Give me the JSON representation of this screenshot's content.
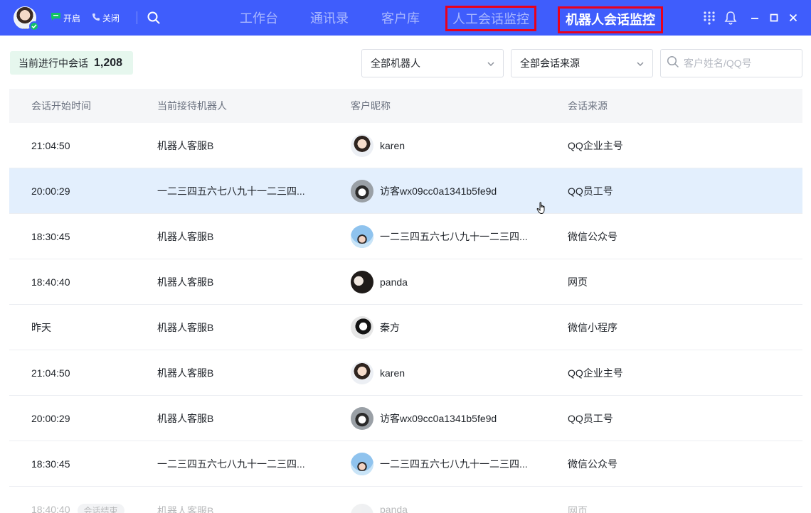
{
  "topbar": {
    "status_open_label": "开启",
    "status_close_label": "关闭",
    "tabs": [
      {
        "label": "工作台"
      },
      {
        "label": "通讯录"
      },
      {
        "label": "客户库"
      },
      {
        "label": "人工会话监控"
      },
      {
        "label": "机器人会话监控"
      }
    ],
    "brand_color": "#3f5dfc",
    "highlight_color": "#e8001c"
  },
  "filters": {
    "count_label": "当前进行中会话",
    "count_value": "1,208",
    "robot_select": "全部机器人",
    "source_select": "全部会话来源",
    "search_placeholder": "客户姓名/QQ号"
  },
  "table": {
    "headers": [
      "会话开始时间",
      "当前接待机器人",
      "客户昵称",
      "会话来源"
    ],
    "rows": [
      {
        "time": "21:04:50",
        "robot": "机器人客服B",
        "nickname": "karen",
        "source": "QQ企业主号",
        "avatar": "woman-avatar"
      },
      {
        "time": "20:00:29",
        "robot": "一二三四五六七八九十一二三四...",
        "nickname": "访客wx09cc0a1341b5fe9d",
        "source": "QQ员工号",
        "avatar": "cat-avatar"
      },
      {
        "time": "18:30:45",
        "robot": "机器人客服B",
        "nickname": "一二三四五六七八九十一二三四...",
        "source": "微信公众号",
        "avatar": "sky-avatar"
      },
      {
        "time": "18:40:40",
        "robot": "机器人客服B",
        "nickname": "panda",
        "source": "网页",
        "avatar": "dark-avatar"
      },
      {
        "time": "昨天",
        "robot": "机器人客服B",
        "nickname": "秦方",
        "source": "微信小程序",
        "avatar": "bw-avatar"
      },
      {
        "time": "21:04:50",
        "robot": "机器人客服B",
        "nickname": "karen",
        "source": "QQ企业主号",
        "avatar": "woman-avatar"
      },
      {
        "time": "20:00:29",
        "robot": "机器人客服B",
        "nickname": "访客wx09cc0a1341b5fe9d",
        "source": "QQ员工号",
        "avatar": "cat-avatar"
      },
      {
        "time": "18:30:45",
        "robot": "一二三四五六七八九十一二三四...",
        "nickname": "一二三四五六七八九十一二三四...",
        "source": "微信公众号",
        "avatar": "sky-avatar"
      },
      {
        "time": "18:40:40",
        "robot": "机器人客服B",
        "nickname": "panda",
        "source": "网页",
        "avatar": "grey-avatar",
        "tag": "会话结束"
      }
    ]
  }
}
